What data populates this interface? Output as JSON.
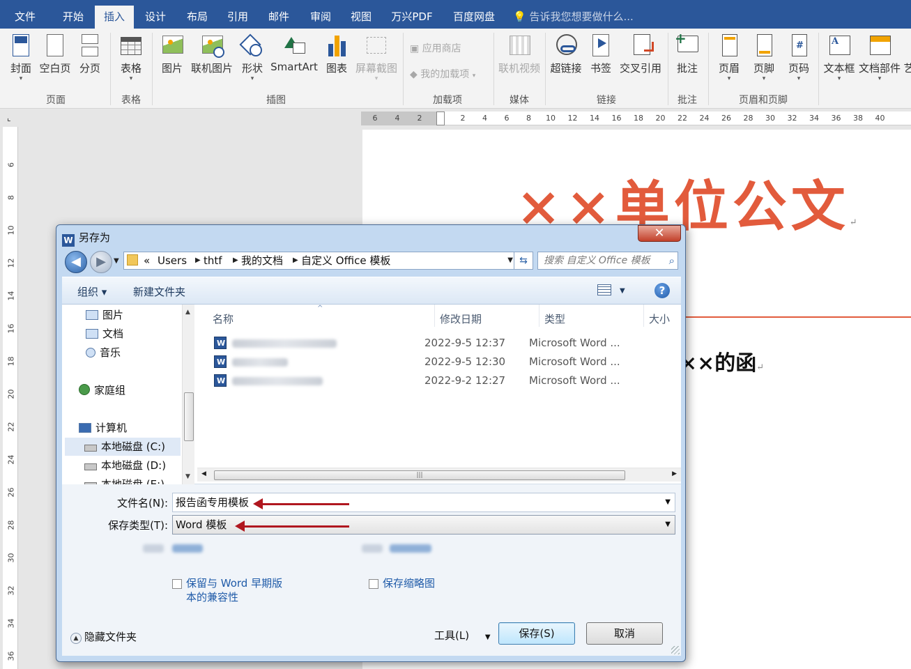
{
  "ribbon_tabs": [
    "文件",
    "开始",
    "插入",
    "设计",
    "布局",
    "引用",
    "邮件",
    "审阅",
    "视图",
    "万兴PDF",
    "百度网盘"
  ],
  "active_tab": "插入",
  "tell_me": "告诉我您想要做什么...",
  "ribbon": {
    "page_group": {
      "label": "页面",
      "cover": "封面",
      "blank": "空白页",
      "break": "分页"
    },
    "table_group": {
      "label": "表格",
      "table": "表格"
    },
    "illus_group": {
      "label": "插图",
      "picture": "图片",
      "online_picture": "联机图片",
      "shapes": "形状",
      "smartart": "SmartArt",
      "chart": "图表",
      "screenshot": "屏幕截图"
    },
    "addins_group": {
      "label": "加载项",
      "store": "应用商店",
      "my_addins": "我的加载项"
    },
    "media_group": {
      "label": "媒体",
      "online_video": "联机视频"
    },
    "links_group": {
      "label": "链接",
      "hyperlink": "超链接",
      "bookmark": "书签",
      "crossref": "交叉引用"
    },
    "comments_group": {
      "label": "批注",
      "comment": "批注"
    },
    "hf_group": {
      "label": "页眉和页脚",
      "header": "页眉",
      "footer": "页脚",
      "page_number": "页码"
    },
    "text_group": {
      "textbox": "文本框",
      "parts": "文档部件",
      "art_partial": "艺"
    }
  },
  "ruler_h": [
    "6",
    "4",
    "2",
    "2",
    "4",
    "6",
    "8",
    "10",
    "12",
    "14",
    "16",
    "18",
    "20",
    "22",
    "24",
    "26",
    "28",
    "30",
    "32",
    "34",
    "36",
    "38",
    "40"
  ],
  "ruler_v": [
    "6",
    "8",
    "10",
    "12",
    "14",
    "16",
    "18",
    "20",
    "22",
    "24",
    "26",
    "28",
    "30",
    "32",
    "34",
    "36"
  ],
  "document": {
    "title": "××单位公文",
    "subtitle": "××的函",
    "accent": "#e25b3c"
  },
  "dialog": {
    "title": "另存为",
    "close_label": "✕",
    "breadcrumb": [
      "«",
      "Users",
      "thtf",
      "我的文档",
      "自定义 Office 模板"
    ],
    "search_placeholder": "搜索 自定义 Office 模板",
    "toolbar": {
      "organize": "组织 ▾",
      "new_folder": "新建文件夹"
    },
    "nav": [
      {
        "label": "图片",
        "icon": "pictures-icon"
      },
      {
        "label": "文档",
        "icon": "documents-icon"
      },
      {
        "label": "音乐",
        "icon": "music-icon"
      },
      {
        "label": "家庭组",
        "icon": "homegroup-icon"
      },
      {
        "label": "计算机",
        "icon": "computer-icon"
      },
      {
        "label": "本地磁盘 (C:)",
        "icon": "drive-icon"
      },
      {
        "label": "本地磁盘 (D:)",
        "icon": "drive-icon"
      },
      {
        "label": "本地磁盘 (E:)",
        "icon": "drive-icon"
      }
    ],
    "columns": [
      "名称",
      "修改日期",
      "类型",
      "大小"
    ],
    "files": [
      {
        "date": "2022-9-5 12:37",
        "type": "Microsoft Word ..."
      },
      {
        "date": "2022-9-5 12:30",
        "type": "Microsoft Word ..."
      },
      {
        "date": "2022-9-2 12:27",
        "type": "Microsoft Word ..."
      }
    ],
    "filename_label": "文件名(N):",
    "filename_value": "报告函专用模板",
    "filetype_label": "保存类型(T):",
    "filetype_value": "Word 模板",
    "compat_checkbox": "保留与 Word 早期版",
    "compat_checkbox_line2": "本的兼容性",
    "thumb_checkbox": "保存缩略图",
    "hide_folders": "隐藏文件夹",
    "tools": "工具(L)",
    "save": "保存(S)",
    "cancel": "取消"
  }
}
